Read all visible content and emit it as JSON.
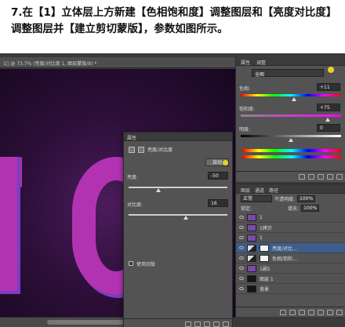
{
  "caption": {
    "line1": "7.在【1】立体层上方新建【色相饱和度】调整图层和【亮度对比度】",
    "line2": "调整图层并【建立剪切蒙版】，参数如图所示。"
  },
  "doctab": {
    "title": "1\u0000 @ 73.7% (亮度/对比度 1, 图层蒙版/8) *"
  },
  "properties": {
    "panel_title": "属性",
    "header": "亮度/对比度",
    "auto_label": "自动",
    "brightness_label": "亮度:",
    "brightness_value": "-50",
    "brightness_level": 0.3,
    "contrast_label": "对比度:",
    "contrast_value": "16",
    "contrast_level": 0.58,
    "legacy_label": "使用旧版"
  },
  "hue": {
    "tab1": "属性",
    "tab2": "调整",
    "preset": "全图",
    "hue_label": "色相:",
    "hue_value": "+11",
    "hue_level": 0.53,
    "sat_label": "饱和度:",
    "sat_value": "+75",
    "sat_level": 0.87,
    "light_label": "明度:",
    "light_value": "0",
    "light_level": 0.5
  },
  "layers": {
    "tabs": [
      "图层",
      "通道",
      "路径"
    ],
    "blend_mode": "正常",
    "opacity_label": "不透明度:",
    "opacity_value": "100%",
    "fill_label": "填充:",
    "fill_value": "100%",
    "lock_label": "锁定:",
    "items": [
      {
        "name": "1",
        "thumb": "purple",
        "selected": false
      },
      {
        "name": "1拷贝",
        "thumb": "purple",
        "selected": false
      },
      {
        "name": "1",
        "thumb": "purple",
        "selected": false
      },
      {
        "name": "亮度/对比...",
        "thumb": "adj",
        "selected": true
      },
      {
        "name": "色相/饱和...",
        "thumb": "adj",
        "selected": false
      },
      {
        "name": "1副1",
        "thumb": "purple",
        "selected": false
      },
      {
        "name": "图层 1",
        "thumb": "dark",
        "selected": false
      },
      {
        "name": "背景",
        "thumb": "dark",
        "selected": false
      }
    ]
  },
  "colors": {
    "accent_yellow": "#e6d12a",
    "magenta": "#b233b2",
    "canvas_bg": "#2d0f39"
  }
}
